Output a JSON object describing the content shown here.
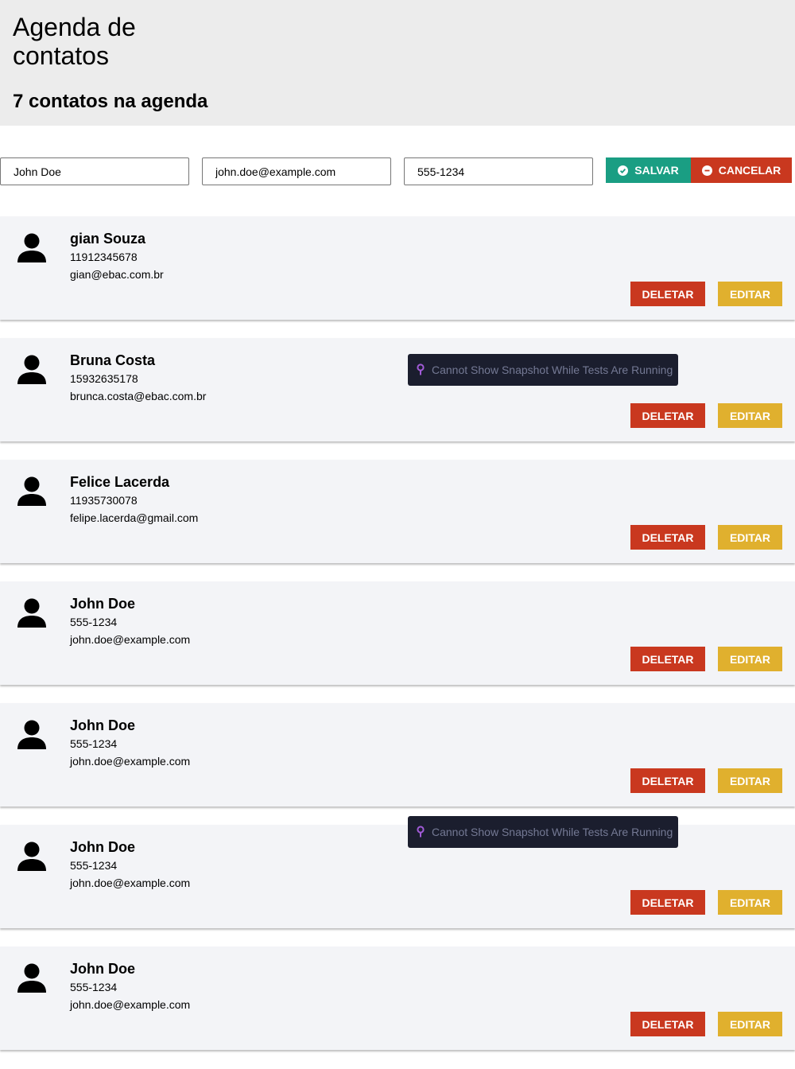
{
  "header": {
    "title": "Agenda de contatos",
    "count_text": "7 contatos na agenda"
  },
  "form": {
    "name_value": "John Doe",
    "email_value": "john.doe@example.com",
    "phone_value": "555-1234",
    "save_label": "SALVAR",
    "cancel_label": "CANCELAR",
    "save_icon": "check-circle-icon",
    "cancel_icon": "minus-circle-icon"
  },
  "contacts": [
    {
      "name": "gian Souza",
      "phone": "11912345678",
      "email": "gian@ebac.com.br"
    },
    {
      "name": "Bruna Costa",
      "phone": "15932635178",
      "email": "brunca.costa@ebac.com.br"
    },
    {
      "name": "Felice Lacerda",
      "phone": "11935730078",
      "email": "felipe.lacerda@gmail.com"
    },
    {
      "name": "John Doe",
      "phone": "555-1234",
      "email": "john.doe@example.com"
    },
    {
      "name": "John Doe",
      "phone": "555-1234",
      "email": "john.doe@example.com"
    },
    {
      "name": "John Doe",
      "phone": "555-1234",
      "email": "john.doe@example.com"
    },
    {
      "name": "John Doe",
      "phone": "555-1234",
      "email": "john.doe@example.com"
    }
  ],
  "card_buttons": {
    "delete_label": "DELETAR",
    "edit_label": "EDITAR"
  },
  "snapshot_notice": {
    "text": "Cannot Show Snapshot While Tests Are Running",
    "icon": "pin-icon"
  },
  "colors": {
    "save": "#1a9e83",
    "cancel": "#c9381f",
    "delete": "#c9381f",
    "edit": "#e0b02e",
    "notice_bg": "#1b1e2e",
    "notice_icon": "#a25bd8"
  }
}
